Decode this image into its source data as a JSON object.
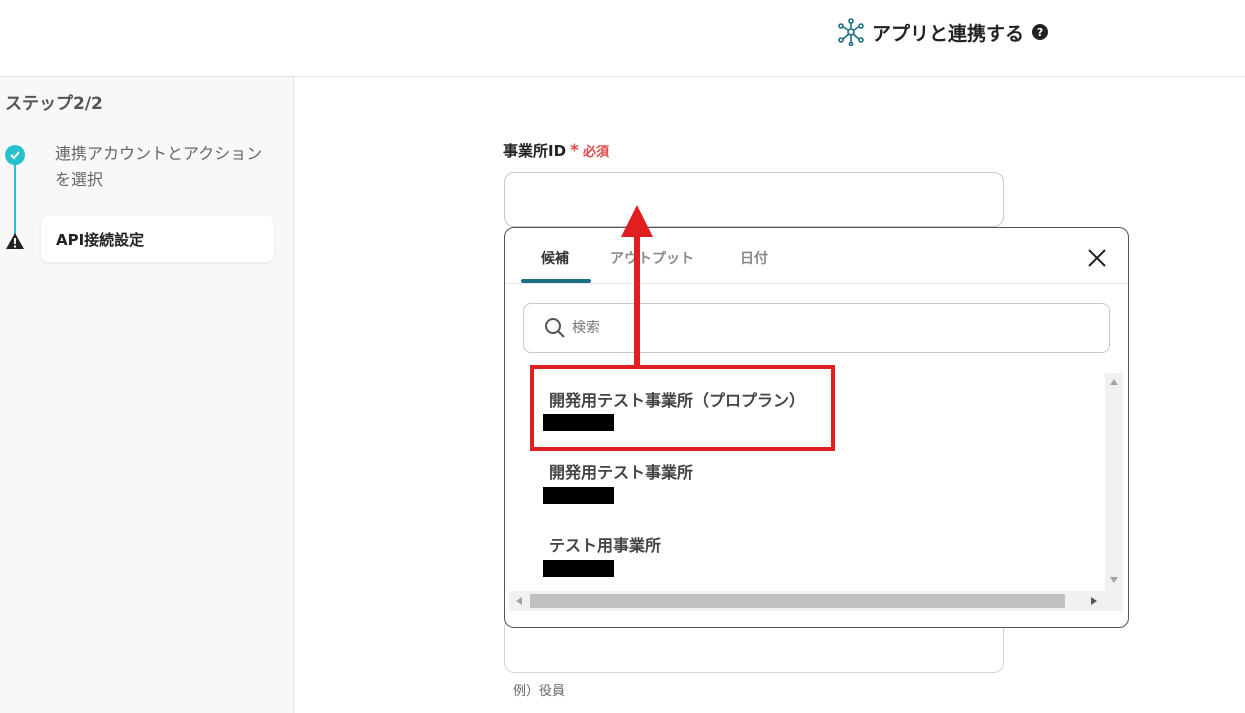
{
  "header": {
    "title": "アプリと連携する",
    "help": "?"
  },
  "sidebar": {
    "step_title": "ステップ2/2",
    "steps": [
      {
        "label": "連携アカウントとアクションを選択",
        "status": "done"
      },
      {
        "label": "API接続設定",
        "status": "warning"
      }
    ]
  },
  "form": {
    "office_id": {
      "label": "事業所ID",
      "required_mark": "*",
      "required_text": "必須",
      "value": ""
    },
    "lower_field": {
      "value": "",
      "hint": "例）役員"
    }
  },
  "popup": {
    "tabs": [
      {
        "label": "候補",
        "active": true
      },
      {
        "label": "アウトプット",
        "active": false
      },
      {
        "label": "日付",
        "active": false
      }
    ],
    "search": {
      "placeholder": "検索",
      "value": ""
    },
    "items": [
      {
        "name": "開発用テスト事業所（プロプラン）",
        "highlighted": true
      },
      {
        "name": "開発用テスト事業所",
        "highlighted": false
      },
      {
        "name": "テスト用事業所",
        "highlighted": false
      }
    ]
  },
  "colors": {
    "accent": "#27c0cf",
    "tab_underline": "#1c6f82",
    "required": "#e04848",
    "annotation": "#e02020"
  },
  "icons": {
    "header": "network-nodes-icon",
    "step_done": "check-circle-icon",
    "step_warning": "warning-triangle-icon",
    "search": "search-icon",
    "close": "close-icon"
  }
}
